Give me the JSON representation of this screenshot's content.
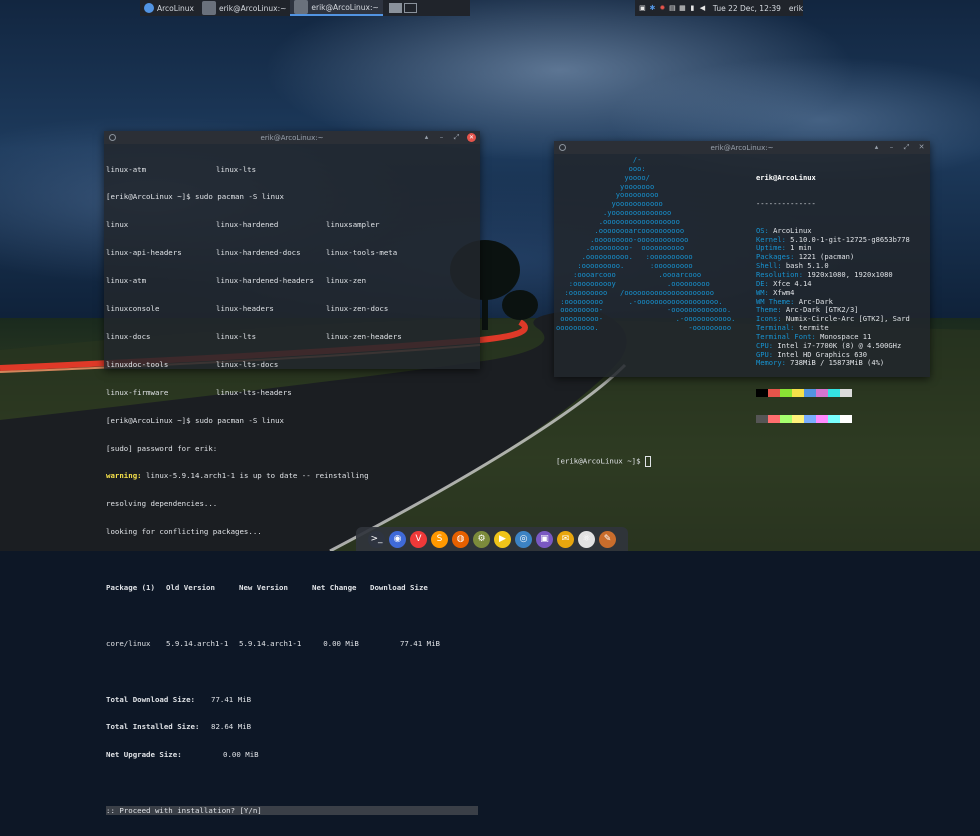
{
  "panel": {
    "tasks": [
      {
        "label": "ArcoLinux",
        "active": false
      },
      {
        "label": "erik@ArcoLinux:~",
        "active": false
      },
      {
        "label": "erik@ArcoLinux:~",
        "active": true
      }
    ],
    "clock": "Tue 22 Dec, 12:39",
    "user": "erik"
  },
  "terminal1": {
    "title": "erik@ArcoLinux:~",
    "lines_top": [
      [
        "linux-atm",
        "linux-lts",
        ""
      ],
      [
        "[erik@ArcoLinux ~]$ sudo pacman -S linux",
        "",
        ""
      ],
      [
        "linux",
        "linux-hardened",
        "linuxsampler"
      ],
      [
        "linux-api-headers",
        "linux-hardened-docs",
        "linux-tools-meta"
      ],
      [
        "linux-atm",
        "linux-hardened-headers",
        "linux-zen"
      ],
      [
        "linuxconsole",
        "linux-headers",
        "linux-zen-docs"
      ],
      [
        "linux-docs",
        "linux-lts",
        "linux-zen-headers"
      ],
      [
        "linuxdoc-tools",
        "linux-lts-docs",
        ""
      ],
      [
        "linux-firmware",
        "linux-lts-headers",
        ""
      ]
    ],
    "cmd2": "[erik@ArcoLinux ~]$ sudo pacman -S linux",
    "sudo": "[sudo] password for erik:",
    "warning_label": "warning:",
    "warning_text": " linux-5.9.14.arch1-1 is up to date -- reinstalling",
    "resolving": "resolving dependencies...",
    "conflicts": "looking for conflicting packages...",
    "table_header": [
      "Package (1)",
      "Old Version",
      "New Version",
      "Net Change",
      "Download Size"
    ],
    "table_row": [
      "core/linux",
      "5.9.14.arch1-1",
      "5.9.14.arch1-1",
      "0.00 MiB",
      "77.41 MiB"
    ],
    "summary": [
      [
        "Total Download Size:",
        "77.41 MiB"
      ],
      [
        "Total Installed Size:",
        "82.64 MiB"
      ],
      [
        "Net Upgrade Size:",
        "0.00 MiB"
      ]
    ],
    "proceed": ":: Proceed with installation? [Y/n]"
  },
  "terminal2": {
    "title": "erik@ArcoLinux:~",
    "logo": [
      "                  /-",
      "                 ooo:",
      "                yoooo/",
      "               yooooooo",
      "              yooooooooo",
      "             yooooooooooo",
      "           .yoooooooooooooo",
      "          .oooooooooooooooooo",
      "         .oooooooarcoooooooooo",
      "        .ooooooooo-oooooooooooo",
      "       .ooooooooo-  oooooooooo",
      "      .oooooooooo.   :oooooooooo",
      "     :ooooooooo.      :ooooooooo",
      "    :oooarcooo          .oooarcooo",
      "   :oooooooooy            .ooooooooo",
      "  :ooooooooo   /ooooooooooooooooooooo",
      " :ooooooooo      .-ooooooooooooooooooo.",
      " ooooooooo-               -ooooooooooooo.",
      " ooooooooo-                 .-ooooooooooo.",
      "ooooooooo.                     -ooooooooo"
    ],
    "header": "erik@ArcoLinux",
    "separator": "--------------",
    "info": [
      {
        "k": "OS",
        "v": "ArcoLinux"
      },
      {
        "k": "Kernel",
        "v": "5.10.0-1-git-12725-g8653b778"
      },
      {
        "k": "Uptime",
        "v": "1 min"
      },
      {
        "k": "Packages",
        "v": "1221 (pacman)"
      },
      {
        "k": "Shell",
        "v": "bash 5.1.0"
      },
      {
        "k": "Resolution",
        "v": "1920x1080, 1920x1080"
      },
      {
        "k": "DE",
        "v": "Xfce 4.14"
      },
      {
        "k": "WM",
        "v": "Xfwm4"
      },
      {
        "k": "WM Theme",
        "v": "Arc-Dark"
      },
      {
        "k": "Theme",
        "v": "Arc-Dark [GTK2/3]"
      },
      {
        "k": "Icons",
        "v": "Numix-Circle-Arc [GTK2], Sard"
      },
      {
        "k": "Terminal",
        "v": "termite"
      },
      {
        "k": "Terminal Font",
        "v": "Monospace 11"
      },
      {
        "k": "CPU",
        "v": "Intel i7-7700K (8) @ 4.500GHz"
      },
      {
        "k": "GPU",
        "v": "Intel HD Graphics 630"
      },
      {
        "k": "Memory",
        "v": "738MiB / 15873MiB (4%)"
      }
    ],
    "swatch_row1": [
      "#000000",
      "#e6544b",
      "#8ae234",
      "#f5e04a",
      "#5294e2",
      "#d475d0",
      "#34e2e2",
      "#dcdcdc"
    ],
    "swatch_row2": [
      "#555555",
      "#ff6e6e",
      "#a6ff6e",
      "#fff27a",
      "#7aaeff",
      "#ff8bff",
      "#7affff",
      "#ffffff"
    ],
    "prompt": "[erik@ArcoLinux ~]$ "
  },
  "dock": [
    {
      "name": "terminal-icon",
      "glyph": ">_",
      "color": "#2e3440"
    },
    {
      "name": "screenshot-icon",
      "glyph": "◉",
      "color": "#3f6ad8"
    },
    {
      "name": "vivaldi-icon",
      "glyph": "V",
      "color": "#ef3939"
    },
    {
      "name": "sublime-icon",
      "glyph": "S",
      "color": "#ff9800"
    },
    {
      "name": "firefox-icon",
      "glyph": "◍",
      "color": "#e66000"
    },
    {
      "name": "settings-icon",
      "glyph": "⚙",
      "color": "#7c8b3b"
    },
    {
      "name": "media-player-icon",
      "glyph": "▶",
      "color": "#f0c419"
    },
    {
      "name": "chromium-icon",
      "glyph": "◎",
      "color": "#3c83c4"
    },
    {
      "name": "file-manager-icon",
      "glyph": "▣",
      "color": "#7a58c2"
    },
    {
      "name": "mail-icon",
      "glyph": "✉",
      "color": "#e8a60e"
    },
    {
      "name": "atom-icon",
      "glyph": "⚛",
      "color": "#e2e2e2"
    },
    {
      "name": "gimp-icon",
      "glyph": "✎",
      "color": "#c96d2c"
    }
  ]
}
